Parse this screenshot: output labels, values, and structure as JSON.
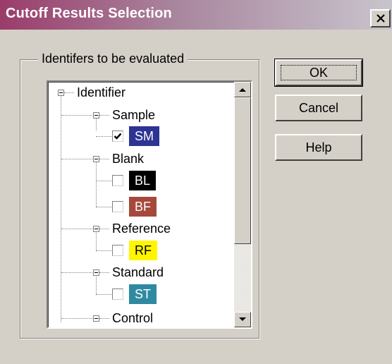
{
  "window": {
    "title": "Cutoff Results Selection"
  },
  "group": {
    "label": "Identifers to be evaluated"
  },
  "tree": {
    "root": "Identifier",
    "nodes": [
      {
        "label": "Sample",
        "items": [
          {
            "code": "SM",
            "checked": true,
            "color": "#2d3494",
            "text_color": "#ffffff"
          }
        ]
      },
      {
        "label": "Blank",
        "items": [
          {
            "code": "BL",
            "checked": false,
            "color": "#000000",
            "text_color": "#ffffff"
          },
          {
            "code": "BF",
            "checked": false,
            "color": "#a5493c",
            "text_color": "#ffffff"
          }
        ]
      },
      {
        "label": "Reference",
        "items": [
          {
            "code": "RF",
            "checked": false,
            "color": "#fff500",
            "text_color": "#000000"
          }
        ]
      },
      {
        "label": "Standard",
        "items": [
          {
            "code": "ST",
            "checked": false,
            "color": "#2f8aa1",
            "text_color": "#ffffff"
          }
        ]
      },
      {
        "label": "Control",
        "items": []
      }
    ]
  },
  "buttons": {
    "ok": "OK",
    "cancel": "Cancel",
    "help": "Help"
  }
}
